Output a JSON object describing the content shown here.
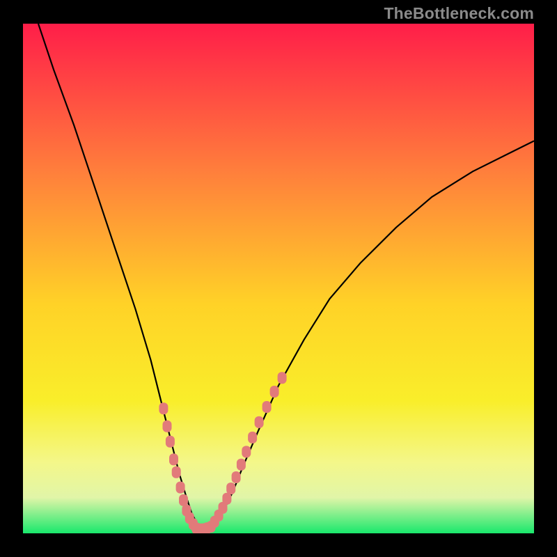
{
  "watermark": "TheBottleneck.com",
  "colors": {
    "frame": "#000000",
    "grad_top": "#ff1e49",
    "grad_mid1": "#ff823b",
    "grad_mid2": "#ffd227",
    "grad_mid3": "#f9ee2a",
    "grad_low1": "#f4f789",
    "grad_low2": "#e1f5a8",
    "grad_bottom": "#19e86c",
    "curve": "#000000",
    "marker": "#e27a7a"
  },
  "chart_data": {
    "type": "line",
    "title": "",
    "xlabel": "",
    "ylabel": "",
    "xlim": [
      0,
      100
    ],
    "ylim": [
      0,
      100
    ],
    "series": [
      {
        "name": "bottleneck-curve",
        "x": [
          3,
          6,
          10,
          14,
          18,
          22,
          25,
          27,
          29,
          30.5,
          32,
          33,
          34,
          35,
          36,
          37.5,
          39,
          41,
          43,
          46,
          50,
          55,
          60,
          66,
          73,
          80,
          88,
          96,
          100
        ],
        "values": [
          100,
          91,
          80,
          68,
          56,
          44,
          34,
          26,
          18,
          12,
          7,
          4,
          2,
          1,
          1,
          2,
          4,
          8,
          13,
          20,
          29,
          38,
          46,
          53,
          60,
          66,
          71,
          75,
          77
        ]
      }
    ],
    "markers": [
      {
        "name": "left-descent-dots",
        "x": [
          27.5,
          28.2,
          28.8,
          29.5,
          30.0,
          30.8,
          31.4,
          32.0,
          32.6,
          33.3,
          33.9
        ],
        "values": [
          24.5,
          21.0,
          18.0,
          14.5,
          12.0,
          9.0,
          6.5,
          4.5,
          3.0,
          1.8,
          1.0
        ]
      },
      {
        "name": "bottom-dots",
        "x": [
          34.5,
          35.2,
          36.0,
          36.8
        ],
        "values": [
          0.8,
          0.8,
          1.0,
          1.3
        ]
      },
      {
        "name": "right-ascent-dots",
        "x": [
          37.5,
          38.3,
          39.1,
          39.9,
          40.7,
          41.7,
          42.7,
          43.7,
          44.9,
          46.2,
          47.7,
          49.2,
          50.7
        ],
        "values": [
          2.3,
          3.5,
          5.0,
          6.8,
          8.8,
          11.0,
          13.5,
          16.0,
          18.8,
          21.8,
          24.8,
          27.8,
          30.5
        ]
      }
    ]
  }
}
